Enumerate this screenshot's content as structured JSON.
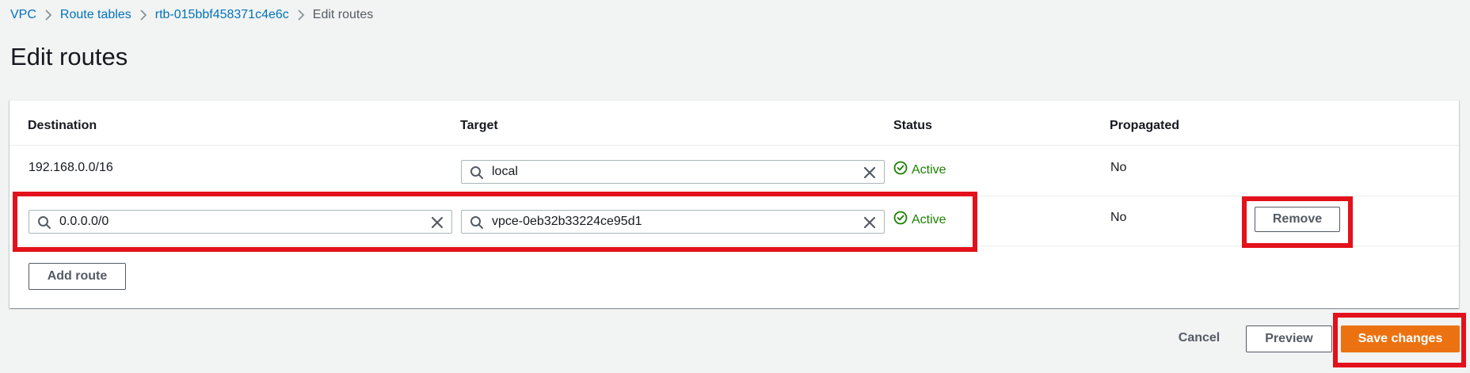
{
  "breadcrumb": {
    "items": [
      "VPC",
      "Route tables",
      "rtb-015bbf458371c4e6c"
    ],
    "current": "Edit routes"
  },
  "page_title": "Edit routes",
  "table": {
    "headers": {
      "destination": "Destination",
      "target": "Target",
      "status": "Status",
      "propagated": "Propagated"
    },
    "rows": [
      {
        "destination": "192.168.0.0/16",
        "target": "local",
        "status": "Active",
        "propagated": "No"
      },
      {
        "destination": "0.0.0.0/0",
        "target": "vpce-0eb32b33224ce95d1",
        "status": "Active",
        "propagated": "No",
        "remove_label": "Remove"
      }
    ]
  },
  "add_route_label": "Add route",
  "footer": {
    "cancel_label": "Cancel",
    "preview_label": "Preview",
    "save_label": "Save changes"
  },
  "colors": {
    "link": "#0073bb",
    "status_active": "#1d8102",
    "primary_button": "#ec7211",
    "highlight": "#e3111b"
  },
  "icons": {
    "search": "search-icon",
    "clear": "close-icon",
    "status_ok": "check-circle-icon",
    "separator": "chevron-right-icon"
  }
}
